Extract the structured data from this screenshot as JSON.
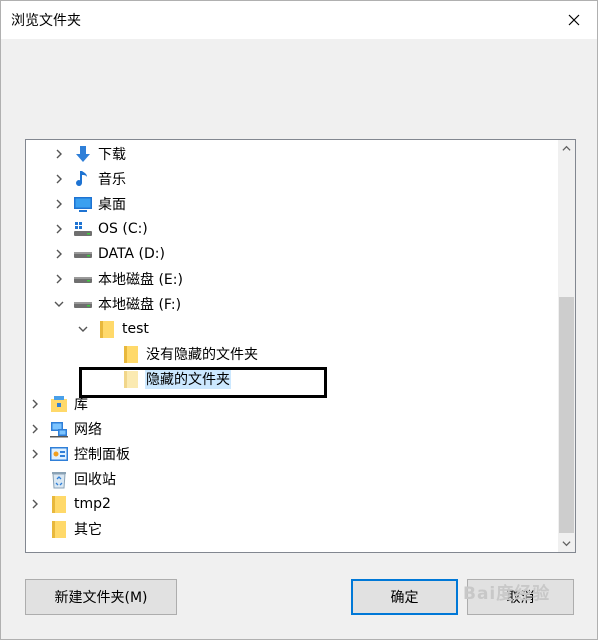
{
  "dialog": {
    "title": "浏览文件夹",
    "close_glyph": "×"
  },
  "tree": {
    "items": [
      {
        "label": "下载",
        "icon": "download-icon",
        "expander": "collapsed"
      },
      {
        "label": "音乐",
        "icon": "music-note-icon",
        "expander": "collapsed"
      },
      {
        "label": "桌面",
        "icon": "desktop-icon",
        "expander": "collapsed"
      },
      {
        "label": "OS (C:)",
        "icon": "system-drive-icon",
        "expander": "collapsed"
      },
      {
        "label": "DATA (D:)",
        "icon": "drive-icon",
        "expander": "collapsed"
      },
      {
        "label": "本地磁盘 (E:)",
        "icon": "drive-icon",
        "expander": "collapsed"
      },
      {
        "label": "本地磁盘 (F:)",
        "icon": "drive-icon",
        "expander": "expanded"
      },
      {
        "label": "test",
        "icon": "folder-icon",
        "expander": "expanded"
      },
      {
        "label": "没有隐藏的文件夹",
        "icon": "folder-icon",
        "expander": "none"
      },
      {
        "label": "隐藏的文件夹",
        "icon": "hidden-folder-icon",
        "expander": "none",
        "selected": true
      },
      {
        "label": "库",
        "icon": "library-icon",
        "expander": "collapsed"
      },
      {
        "label": "网络",
        "icon": "network-icon",
        "expander": "collapsed"
      },
      {
        "label": "控制面板",
        "icon": "control-panel-icon",
        "expander": "collapsed"
      },
      {
        "label": "回收站",
        "icon": "recycle-bin-icon",
        "expander": "none"
      },
      {
        "label": "tmp2",
        "icon": "folder-icon",
        "expander": "collapsed"
      },
      {
        "label": "其它",
        "icon": "folder-icon",
        "expander": "none"
      }
    ]
  },
  "buttons": {
    "new_folder": "新建文件夹(M)",
    "ok": "确定",
    "cancel": "取消"
  },
  "watermark": "Bai度经验",
  "colors": {
    "selection": "#cce8ff",
    "folder": "#ffd96a",
    "accent": "#0078d7"
  }
}
